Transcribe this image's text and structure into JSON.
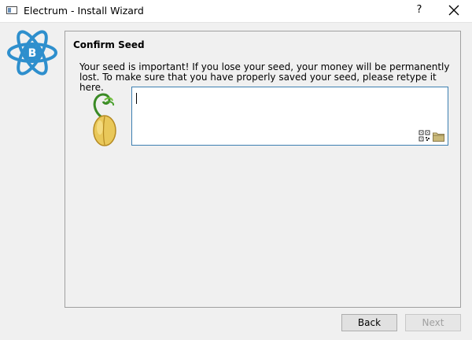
{
  "window": {
    "title": "Electrum  -  Install Wizard",
    "help_glyph": "?",
    "close_icon": "close-icon"
  },
  "brand": {
    "logo_icon": "electrum-bitcoin-atom-logo",
    "accent": "#2e8fcd"
  },
  "page": {
    "title": "Confirm Seed",
    "instructions": "Your seed is important! If you lose your seed, your money will be permanently lost. To make sure that you have properly saved your seed, please retype it here."
  },
  "seed_input": {
    "value": "",
    "icons": [
      "qr-code-icon",
      "folder-icon"
    ]
  },
  "buttons": {
    "back": "Back",
    "next": "Next",
    "next_enabled": false
  }
}
